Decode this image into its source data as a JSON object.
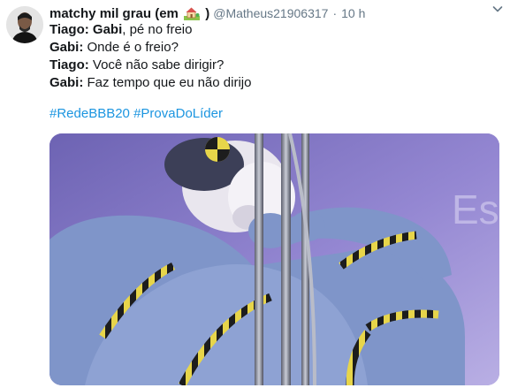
{
  "tweet": {
    "author": {
      "display_name": "matchy mil grau (em",
      "emoji_close": ")",
      "handle": "@Matheus21906317",
      "separator": "·",
      "time": "10 h"
    },
    "lines": [
      {
        "speaker": "Tiago",
        "colon": ":",
        "bold_word": "Gabi",
        "rest": ", pé no freio"
      },
      {
        "speaker": "Gabi",
        "colon": ":",
        "rest": " Onde é o freio?"
      },
      {
        "speaker": "Tiago",
        "colon": ":",
        "rest": " Você não sabe dirigir?"
      },
      {
        "speaker": "Gabi",
        "colon": ":",
        "rest": " Faz tempo que eu não dirijo"
      }
    ],
    "hashtags": [
      "#RedeBBB20",
      "#ProvaDoLíder"
    ],
    "media": {
      "background_text": "Es"
    }
  },
  "colors": {
    "link": "#1b95e0",
    "secondary_text": "#657786",
    "primary_text": "#14171a",
    "media_bg": "#8a7ec8",
    "suit_blue": "#7f95c9"
  },
  "icons": {
    "caret": "chevron-down-icon",
    "house_emoji": "house-with-garden-emoji"
  }
}
